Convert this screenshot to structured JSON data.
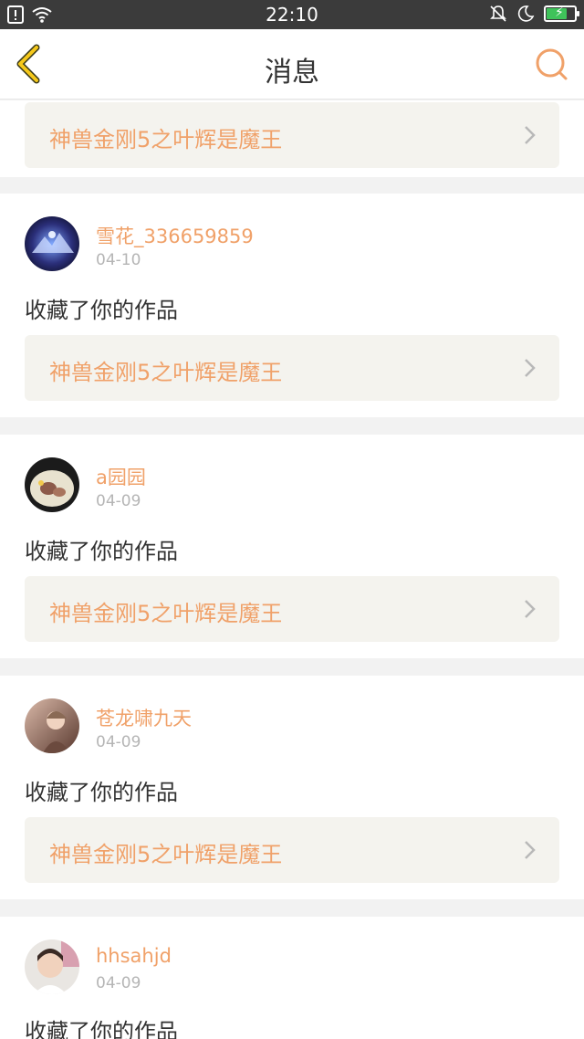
{
  "status_bar": {
    "time": "22:10",
    "icons": [
      "sim-icon",
      "wifi-icon",
      "mute-icon",
      "moon-icon",
      "battery-charging-icon"
    ],
    "battery_level": 0.7
  },
  "header": {
    "title": "消息",
    "back_icon": "back-icon",
    "search_icon": "search-icon"
  },
  "colors": {
    "accent": "#f0a169",
    "back_arrow": "#f5c81b",
    "text": "#333333",
    "date": "#b5b5b5",
    "link_bg": "#f4f3ee"
  },
  "partial_card": {
    "work_title": "神兽金刚5之叶辉是魔王"
  },
  "messages": [
    {
      "user": "雪花_336659859",
      "date": "04-10",
      "action": "收藏了你的作品",
      "work_title": "神兽金刚5之叶辉是魔王"
    },
    {
      "user": "a园园",
      "date": "04-09",
      "action": "收藏了你的作品",
      "work_title": "神兽金刚5之叶辉是魔王"
    },
    {
      "user": "苍龙啸九天",
      "date": "04-09",
      "action": "收藏了你的作品",
      "work_title": "神兽金刚5之叶辉是魔王"
    },
    {
      "user": "hhsahjd",
      "date": "04-09",
      "action": "收藏了你的作品"
    }
  ]
}
